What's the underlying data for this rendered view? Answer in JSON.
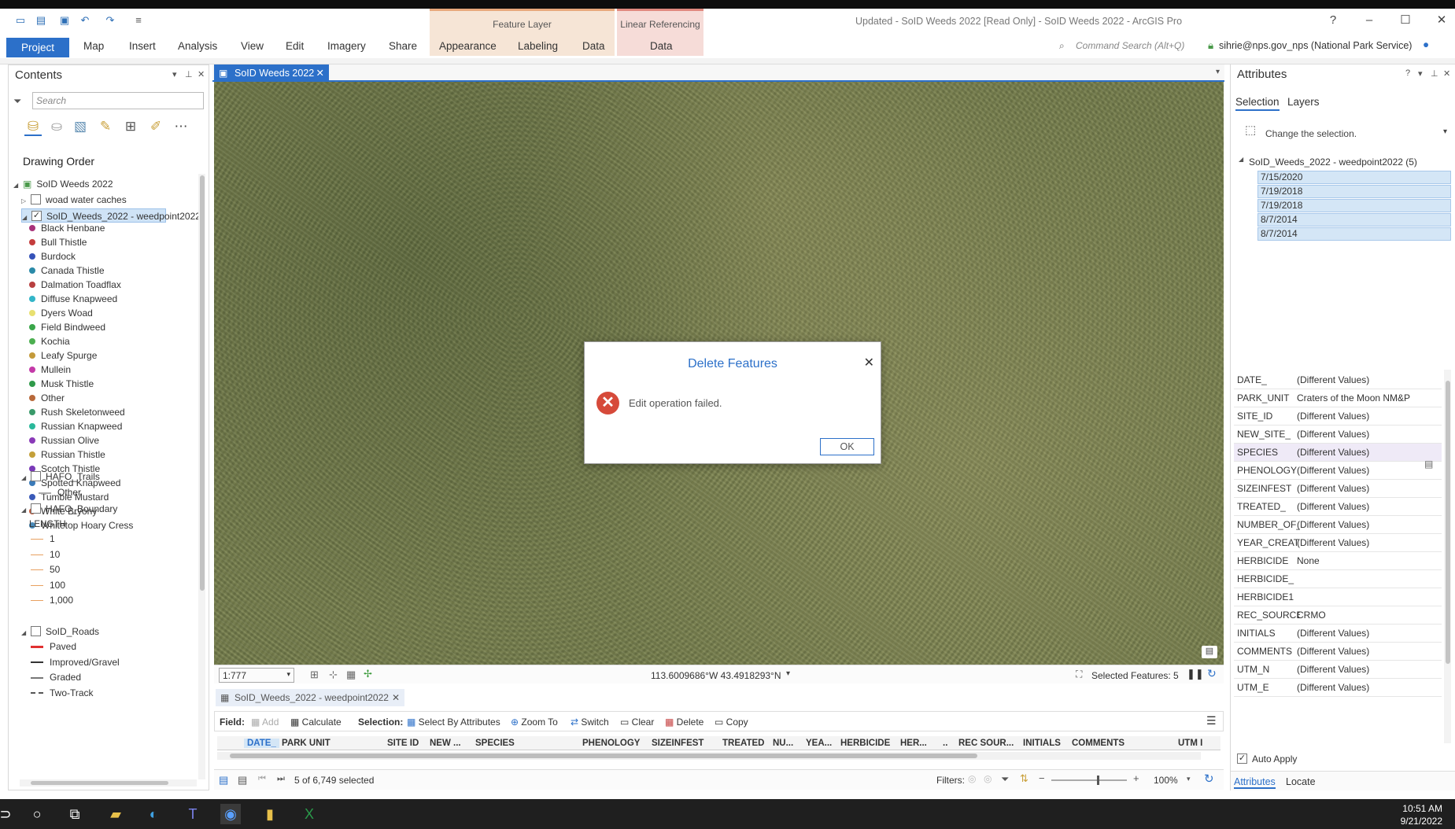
{
  "window": {
    "title": "Updated - SoID Weeds 2022 [Read Only] - SoID Weeds 2022 - ArcGIS Pro",
    "help": "?"
  },
  "ribbon": {
    "tabs": [
      "Project",
      "Map",
      "Insert",
      "Analysis",
      "View",
      "Edit",
      "Imagery",
      "Share",
      "Appearance",
      "Labeling",
      "Data",
      "Data"
    ],
    "contextual_1": "Feature Layer",
    "contextual_2": "Linear Referencing",
    "command_search_placeholder": "Command Search (Alt+Q)",
    "user": "sihrie@nps.gov_nps (National Park Service)"
  },
  "contents": {
    "title": "Contents",
    "search_placeholder": "Search",
    "drawing_order": "Drawing Order",
    "map_name": "SoID Weeds 2022",
    "layers": {
      "woad": "woad water caches",
      "weeds": "SoID_Weeds_2022 - weedpoint2022",
      "hafo_trails": "HAFO_Trails",
      "hafo_trails_other": "Other",
      "hafo_boundary": "HAFO_Boundary",
      "length_label": "LENGTH",
      "roads": "SoID_Roads"
    },
    "species": [
      {
        "name": "Black Henbane",
        "color": "#a8327a"
      },
      {
        "name": "Bull Thistle",
        "color": "#c43d3d"
      },
      {
        "name": "Burdock",
        "color": "#3552b8"
      },
      {
        "name": "Canada Thistle",
        "color": "#2a8aa8"
      },
      {
        "name": "Dalmation Toadflax",
        "color": "#b84040"
      },
      {
        "name": "Diffuse Knapweed",
        "color": "#33b5c8"
      },
      {
        "name": "Dyers Woad",
        "color": "#e8e070"
      },
      {
        "name": "Field Bindweed",
        "color": "#3aa64a"
      },
      {
        "name": "Kochia",
        "color": "#4caf50"
      },
      {
        "name": "Leafy Spurge",
        "color": "#c49a3a"
      },
      {
        "name": "Mullein",
        "color": "#c43aa8"
      },
      {
        "name": "Musk Thistle",
        "color": "#2f9a4a"
      },
      {
        "name": "Other",
        "color": "#b8693a"
      },
      {
        "name": "Rush Skeletonweed",
        "color": "#3a9a6a"
      },
      {
        "name": "Russian Knapweed",
        "color": "#2ab89a"
      },
      {
        "name": "Russian Olive",
        "color": "#8a3ab8"
      },
      {
        "name": "Russian Thistle",
        "color": "#c4a03a"
      },
      {
        "name": "Scotch Thistle",
        "color": "#7a3ab8"
      },
      {
        "name": "Spotted Knapweed",
        "color": "#3a7ab8"
      },
      {
        "name": "Tumble Mustard",
        "color": "#3a5ab8"
      },
      {
        "name": "White Bryony",
        "color": "#c45a3a"
      },
      {
        "name": "Whitetop Hoary Cress",
        "color": "#4a8ab8"
      }
    ],
    "lengths": [
      "1",
      "10",
      "50",
      "100",
      "1,000"
    ],
    "roads": [
      {
        "name": "Paved",
        "color": "#e03030"
      },
      {
        "name": "Improved/Gravel",
        "color": "#333333"
      },
      {
        "name": "Graded",
        "color": "#777777"
      },
      {
        "name": "Two-Track",
        "color": "#555555"
      }
    ]
  },
  "map": {
    "tab": "SoID Weeds 2022",
    "scale": "1:777",
    "coordinates": "113.6009686°W 43.4918293°N",
    "selected_features": "Selected Features: 5"
  },
  "dialog": {
    "title": "Delete Features",
    "message": "Edit operation failed.",
    "ok": "OK"
  },
  "table": {
    "tab": "SoID_Weeds_2022 - weedpoint2022",
    "field_label": "Field:",
    "add": "Add",
    "calculate": "Calculate",
    "selection_label": "Selection:",
    "select_by_attributes": "Select By Attributes",
    "zoom_to": "Zoom To",
    "switch": "Switch",
    "clear": "Clear",
    "delete": "Delete",
    "copy": "Copy",
    "columns": [
      "DATE_",
      "PARK UNIT",
      "SITE ID",
      "NEW ...",
      "SPECIES",
      "PHENOLOGY",
      "SIZEINFEST",
      "TREATED",
      "NU...",
      "YEA...",
      "HERBICIDE",
      "HER...",
      "..",
      "REC SOUR...",
      "INITIALS",
      "COMMENTS",
      "UTM I"
    ],
    "status": "5 of 6,749 selected",
    "filters_label": "Filters:",
    "zoom": "100%"
  },
  "attributes": {
    "title": "Attributes",
    "tab_selection": "Selection",
    "tab_layers": "Layers",
    "change_selection": "Change the selection.",
    "layer_node": "SoID_Weeds_2022 - weedpoint2022 (5)",
    "selected": [
      "7/15/2020",
      "7/19/2018",
      "7/19/2018",
      "8/7/2014",
      "8/7/2014"
    ],
    "fields": [
      {
        "k": "DATE_",
        "v": "(Different Values)"
      },
      {
        "k": "PARK_UNIT",
        "v": "Craters of the Moon NM&P"
      },
      {
        "k": "SITE_ID",
        "v": "(Different Values)"
      },
      {
        "k": "NEW_SITE_",
        "v": "(Different Values)"
      },
      {
        "k": "SPECIES",
        "v": "(Different Values)"
      },
      {
        "k": "PHENOLOGY",
        "v": "(Different Values)"
      },
      {
        "k": "SIZEINFEST",
        "v": "(Different Values)"
      },
      {
        "k": "TREATED_",
        "v": "(Different Values)"
      },
      {
        "k": "NUMBER_OF_",
        "v": "(Different Values)"
      },
      {
        "k": "YEAR_CREAT",
        "v": "(Different Values)"
      },
      {
        "k": "HERBICIDE",
        "v": "None"
      },
      {
        "k": "HERBICIDE_",
        "v": ""
      },
      {
        "k": "HERBICIDE1",
        "v": ""
      },
      {
        "k": "REC_SOURCE",
        "v": "CRMO"
      },
      {
        "k": "INITIALS",
        "v": "(Different Values)"
      },
      {
        "k": "COMMENTS",
        "v": "(Different Values)"
      },
      {
        "k": "UTM_N",
        "v": "(Different Values)"
      },
      {
        "k": "UTM_E",
        "v": "(Different Values)"
      }
    ],
    "auto_apply": "Auto Apply",
    "bottom_tab_attributes": "Attributes",
    "bottom_tab_locate": "Locate"
  },
  "taskbar": {
    "time": "10:51 AM",
    "date": "9/21/2022"
  }
}
